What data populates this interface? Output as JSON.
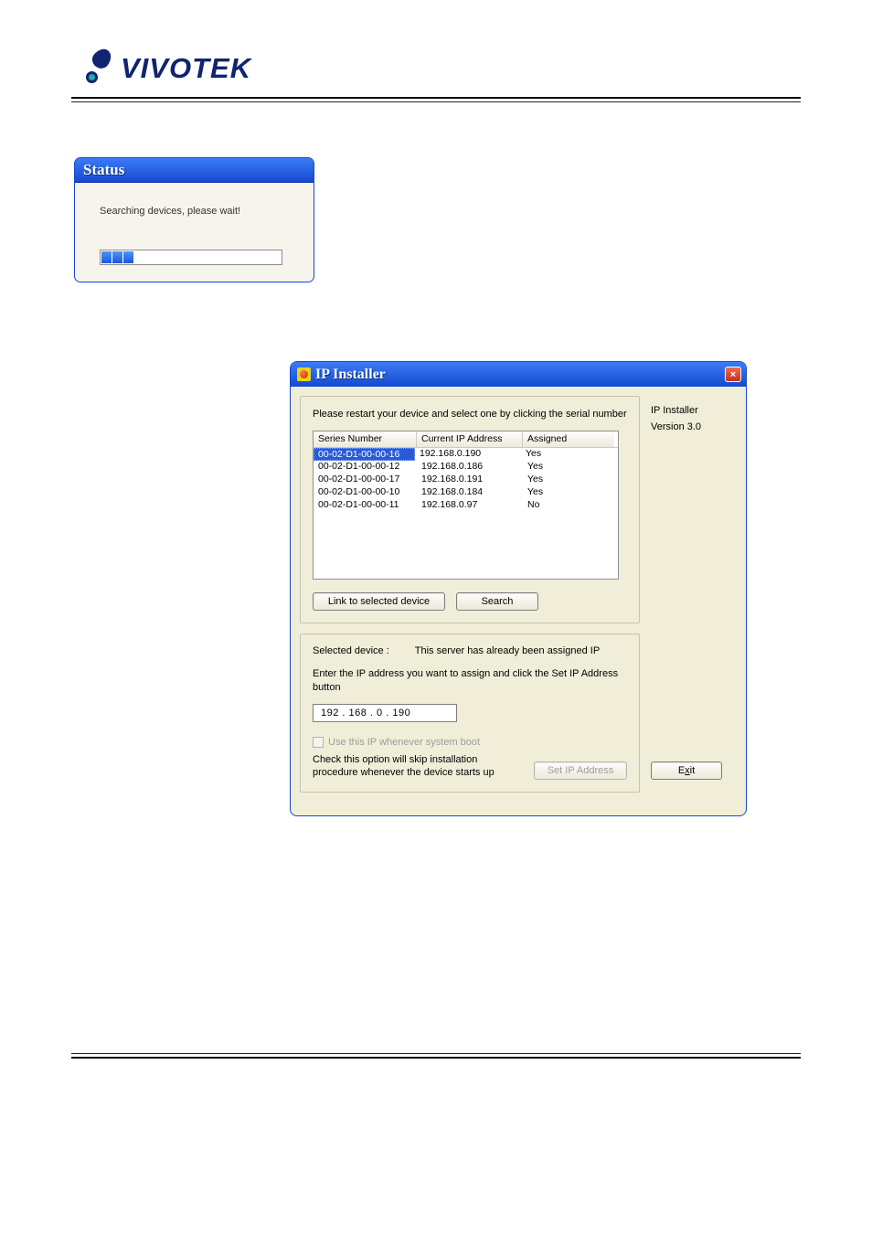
{
  "logo": {
    "wordmark": "VIVOTEK"
  },
  "status_dialog": {
    "title": "Status",
    "message": "Searching devices, please wait!"
  },
  "ip_installer": {
    "title": "IP Installer",
    "close_symbol": "×",
    "side": {
      "line1": "IP Installer",
      "line2": "Version 3.0"
    },
    "group1": {
      "instruction": "Please restart your device and select one by clicking the serial number",
      "columns": {
        "sn": "Series Number",
        "ip": "Current IP Address",
        "as": "Assigned"
      },
      "rows": [
        {
          "sn": "00-02-D1-00-00-16",
          "ip": "192.168.0.190",
          "as": "Yes",
          "selected": true
        },
        {
          "sn": "00-02-D1-00-00-12",
          "ip": "192.168.0.186",
          "as": "Yes",
          "selected": false
        },
        {
          "sn": "00-02-D1-00-00-17",
          "ip": "192.168.0.191",
          "as": "Yes",
          "selected": false
        },
        {
          "sn": "00-02-D1-00-00-10",
          "ip": "192.168.0.184",
          "as": "Yes",
          "selected": false
        },
        {
          "sn": "00-02-D1-00-00-11",
          "ip": "192.168.0.97",
          "as": "No",
          "selected": false
        }
      ],
      "link_btn": "Link to selected device",
      "search_btn": "Search"
    },
    "group2": {
      "selected_label": "Selected device :",
      "selected_status": "This server has already been assigned IP",
      "enter_label": "Enter the IP address you want to assign and click the Set IP Address button",
      "ip_value": "192 . 168 .   0   . 190",
      "use_ip_checkbox": "Use this IP whenever system boot",
      "note_line1": "Check this option will skip installation",
      "note_line2": "procedure whenever the device starts up",
      "set_ip_btn": "Set IP Address"
    },
    "exit_btn_prefix": "E",
    "exit_btn_underlined": "x",
    "exit_btn_suffix": "it"
  }
}
